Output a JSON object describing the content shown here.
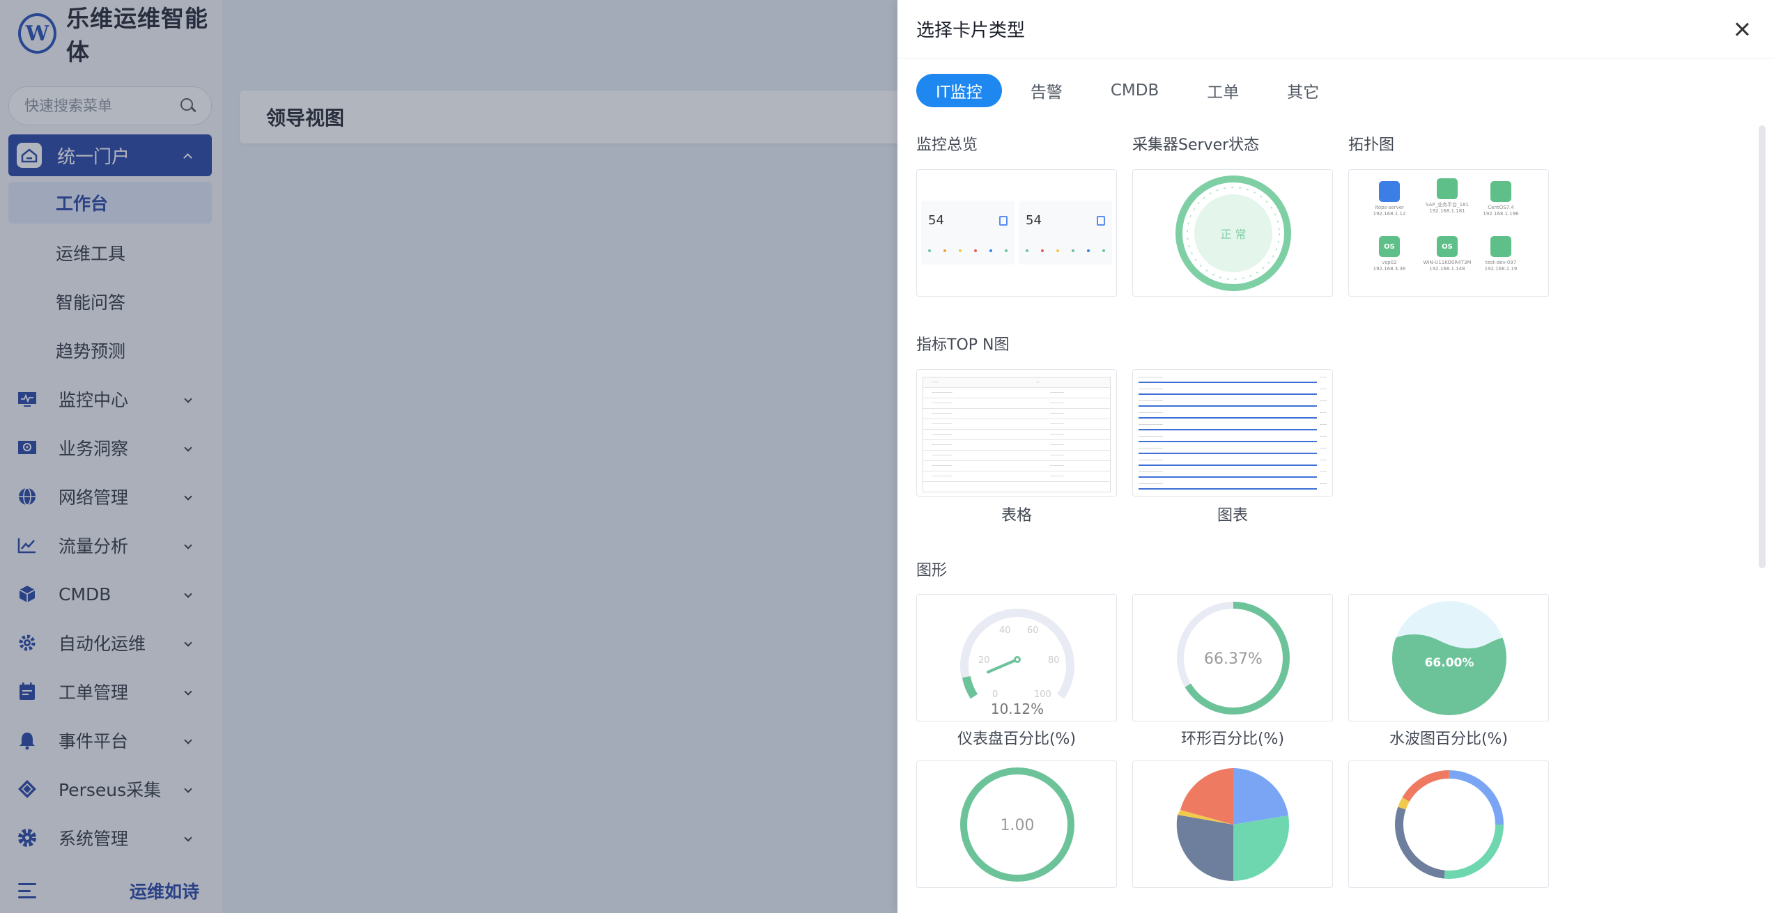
{
  "brand": {
    "logo_text": "W",
    "title": "乐维运维智能体"
  },
  "search": {
    "placeholder": "快速搜索菜单"
  },
  "sidebar": {
    "active": {
      "label": "统一门户"
    },
    "sub_items": [
      {
        "label": "工作台"
      },
      {
        "label": "运维工具"
      },
      {
        "label": "智能问答"
      },
      {
        "label": "趋势预测"
      }
    ],
    "items": [
      {
        "label": "监控中心"
      },
      {
        "label": "业务洞察"
      },
      {
        "label": "网络管理"
      },
      {
        "label": "流量分析"
      },
      {
        "label": "CMDB"
      },
      {
        "label": "自动化运维"
      },
      {
        "label": "工单管理"
      },
      {
        "label": "事件平台"
      },
      {
        "label": "Perseus采集"
      },
      {
        "label": "系统管理"
      }
    ],
    "footer_text": "运维如诗"
  },
  "main": {
    "page_title": "领导视图"
  },
  "drawer": {
    "title": "选择卡片类型",
    "tabs": [
      {
        "label": "IT监控"
      },
      {
        "label": "告警"
      },
      {
        "label": "CMDB"
      },
      {
        "label": "工单"
      },
      {
        "label": "其它"
      }
    ],
    "sections": {
      "overview": "监控总览",
      "collector": "采集器Server状态",
      "topology": "拓扑图",
      "topn": "指标TOP N图",
      "shapes": "图形"
    },
    "previews": {
      "overview_value_1": "54",
      "overview_value_2": "54",
      "collector_status": "正 常",
      "topo_nodes": [
        {
          "icon": "",
          "l1": "Itops-server",
          "l2": "192.168.1.12"
        },
        {
          "icon": "",
          "l1": "SAP_业务平台_181",
          "l2": "192.168.1.181"
        },
        {
          "icon": "",
          "l1": "CentOS7.4",
          "l2": "192.168.1.196"
        },
        {
          "icon": "OS",
          "l1": "vsp02",
          "l2": "192.168.3.36"
        },
        {
          "icon": "OS",
          "l1": "WIN-U11KO0R4T3M",
          "l2": "192.168.1.148"
        },
        {
          "icon": "",
          "l1": "test-dev-097",
          "l2": "192.168.1.19"
        }
      ],
      "gauge_ticks": [
        "0",
        "20",
        "40",
        "60",
        "80",
        "100"
      ],
      "gauge_value": "10.12%",
      "ring_value": "66.37%",
      "wave_value": "66.00%",
      "circle_value": "1.00"
    },
    "captions": {
      "table": "表格",
      "chart": "图表",
      "gauge": "仪表盘百分比(%)",
      "ring": "环形百分比(%)",
      "wave": "水波图百分比(%)"
    },
    "colors": {
      "accent": "#1e88f0",
      "green": "#6cc39a",
      "brand": "#1e3fa3"
    }
  }
}
